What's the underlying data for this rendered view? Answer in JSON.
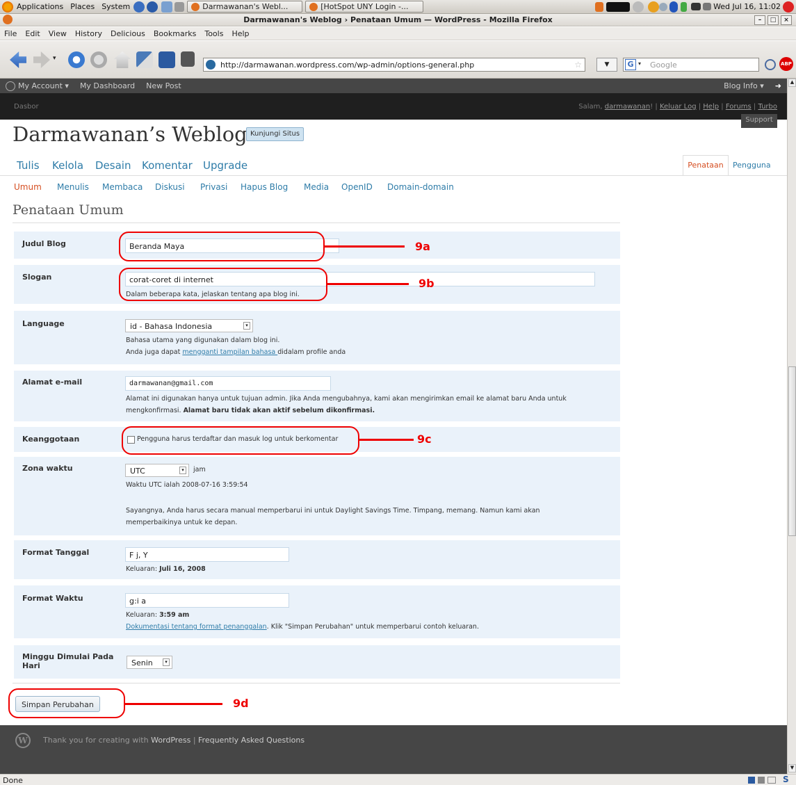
{
  "panel": {
    "apps": "Applications",
    "places": "Places",
    "system": "System",
    "tab1": "Darmawanan's Webl...",
    "tab2": "[HotSpot UNY Login -...",
    "clock": "Wed Jul 16, 11:02"
  },
  "window": {
    "title": "Darmawanan's Weblog › Penataan Umum — WordPress - Mozilla Firefox"
  },
  "menubar": [
    "File",
    "Edit",
    "View",
    "History",
    "Delicious",
    "Bookmarks",
    "Tools",
    "Help"
  ],
  "browser": {
    "url": "http://darmawanan.wordpress.com/wp-admin/options-general.php",
    "search_placeholder": "Google",
    "status": "Done"
  },
  "wpbar": {
    "account": "My Account ▾",
    "dashboard": "My Dashboard",
    "newpost": "New Post",
    "bloginfo": "Blog Info ▾"
  },
  "wpsub": {
    "dasbor": "Dasbor",
    "salam": "Salam,",
    "user": "darmawanan",
    "excl": "!",
    "logout": "Keluar Log",
    "help": "Help",
    "forums": "Forums",
    "turbo": "Turbo",
    "support": "Support"
  },
  "blog": {
    "title": "Darmawanan’s Weblog",
    "visit": "Kunjungi Situs"
  },
  "mainnav": [
    "Tulis",
    "Kelola",
    "Desain",
    "Komentar",
    "Upgrade"
  ],
  "rightnav": [
    "Penataan",
    "Pengguna"
  ],
  "subnav": [
    "Umum",
    "Menulis",
    "Membaca",
    "Diskusi",
    "Privasi",
    "Hapus Blog",
    "Media",
    "OpenID",
    "Domain-domain"
  ],
  "page": {
    "heading": "Penataan Umum"
  },
  "form": {
    "judul_label": "Judul Blog",
    "judul_value": "Beranda Maya",
    "slogan_label": "Slogan",
    "slogan_value": "corat-coret di internet",
    "slogan_hint": "Dalam beberapa kata, jelaskan tentang apa blog ini.",
    "lang_label": "Language",
    "lang_value": "id - Bahasa Indonesia",
    "lang_hint1": "Bahasa utama yang digunakan dalam blog ini.",
    "lang_hint2a": "Anda juga dapat ",
    "lang_hint2b": "mengganti tampilan bahasa ",
    "lang_hint2c": "didalam profile anda",
    "email_label": "Alamat e-mail",
    "email_value": "darmawanan@gmail.com",
    "email_hint1": "Alamat ini digunakan hanya untuk tujuan admin. Jika Anda mengubahnya, kami akan mengirimkan email ke alamat baru Anda untuk",
    "email_hint2a": "mengkonfirmasi. ",
    "email_hint2b": "Alamat baru tidak akan aktif sebelum dikonfirmasi.",
    "anggota_label": "Keanggotaan",
    "anggota_check": "Pengguna harus terdaftar dan masuk log untuk berkomentar",
    "zona_label": "Zona waktu",
    "zona_value": "UTC",
    "zona_unit": "jam",
    "zona_hint1": "Waktu UTC ialah 2008-07-16 3:59:54",
    "zona_hint2": "Sayangnya, Anda harus secara manual memperbarui ini untuk Daylight Savings Time. Timpang, memang. Namun kami akan",
    "zona_hint3": "memperbaikinya untuk ke depan.",
    "tgl_label": "Format Tanggal",
    "tgl_value": "F j, Y",
    "tgl_out_label": "Keluaran: ",
    "tgl_out": "Juli 16, 2008",
    "waktu_label": "Format Waktu",
    "waktu_value": "g:i a",
    "waktu_out_label": "Keluaran: ",
    "waktu_out": "3:59 am",
    "waktu_doc": "Dokumentasi tentang format penanggalan",
    "waktu_doc_rest": ". Klik \"Simpan Perubahan\" untuk memperbarui contoh keluaran.",
    "minggu_label1": "Minggu Dimulai Pada",
    "minggu_label2": "Hari",
    "minggu_value": "Senin",
    "save": "Simpan Perubahan"
  },
  "annot": {
    "a": "9a",
    "b": "9b",
    "c": "9c",
    "d": "9d"
  },
  "footer": {
    "thanks": "Thank you for creating with ",
    "wp": "WordPress",
    "sep": " | ",
    "faq": "Frequently Asked Questions"
  },
  "colors": {
    "accent": "#2e7ca8",
    "annotation": "#e00000",
    "admin_bar": "#464646"
  }
}
